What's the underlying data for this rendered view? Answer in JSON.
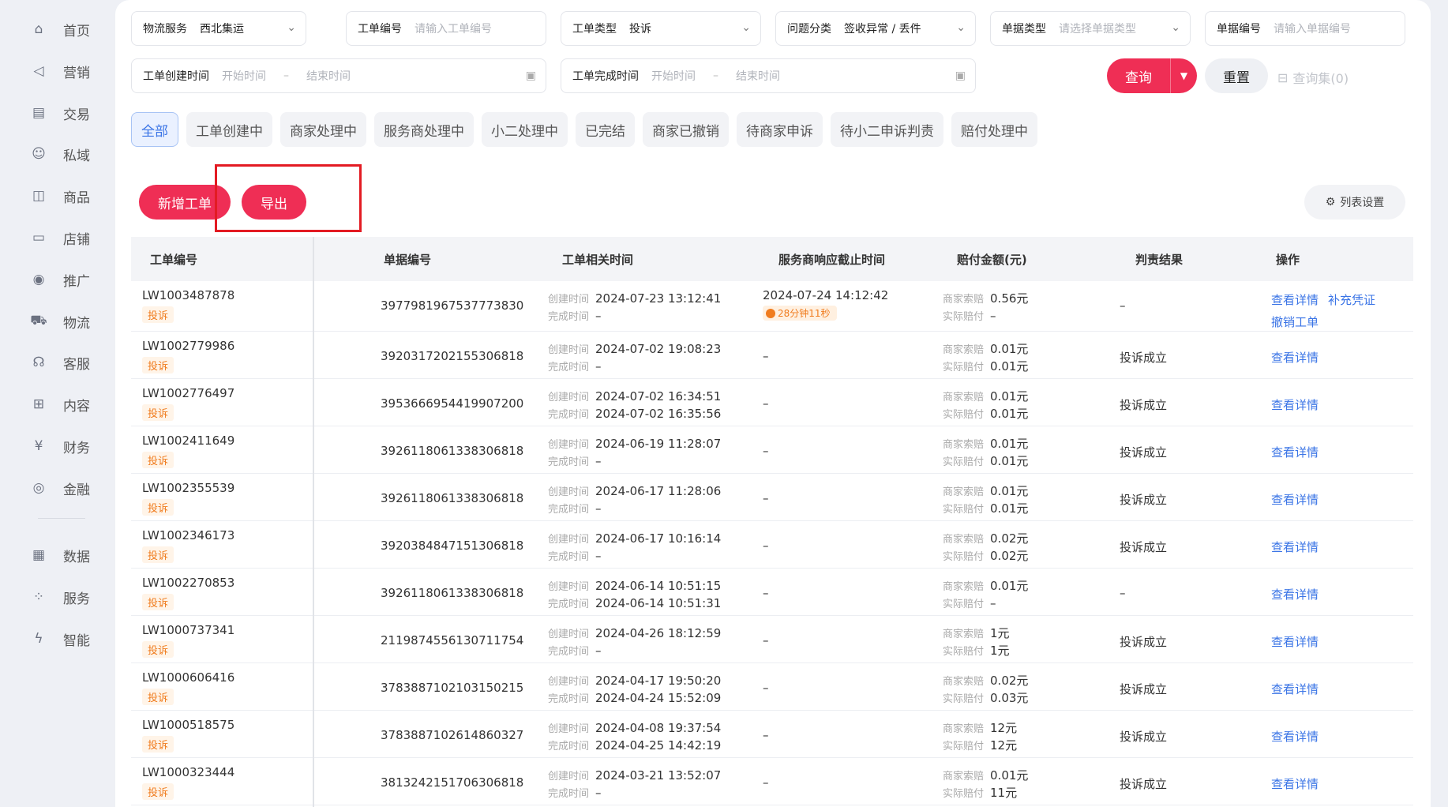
{
  "sidebar": [
    {
      "label": "首页",
      "icon": "home-icon",
      "glyph": "⌂"
    },
    {
      "label": "营销",
      "icon": "megaphone-icon",
      "glyph": "◁"
    },
    {
      "label": "交易",
      "icon": "receipt-icon",
      "glyph": "▤"
    },
    {
      "label": "私域",
      "icon": "users-icon",
      "glyph": "☺"
    },
    {
      "label": "商品",
      "icon": "bag-icon",
      "glyph": "◫"
    },
    {
      "label": "店铺",
      "icon": "store-icon",
      "glyph": "▭"
    },
    {
      "label": "推广",
      "icon": "pin-icon",
      "glyph": "◉"
    },
    {
      "label": "物流",
      "icon": "truck-icon",
      "glyph": "⛟"
    },
    {
      "label": "客服",
      "icon": "headset-icon",
      "glyph": "☊"
    },
    {
      "label": "内容",
      "icon": "content-icon",
      "glyph": "⊞"
    },
    {
      "label": "财务",
      "icon": "yuan-icon",
      "glyph": "¥"
    },
    {
      "label": "金融",
      "icon": "coin-icon",
      "glyph": "◎"
    },
    {
      "label": "数据",
      "icon": "chart-icon",
      "glyph": "▦"
    },
    {
      "label": "服务",
      "icon": "grid-icon",
      "glyph": "⁘"
    },
    {
      "label": "智能",
      "icon": "bolt-icon",
      "glyph": "ϟ"
    }
  ],
  "filters": {
    "logistics": {
      "label": "物流服务",
      "value": "西北集运"
    },
    "ticket_no": {
      "label": "工单编号",
      "placeholder": "请输入工单编号"
    },
    "ticket_type": {
      "label": "工单类型",
      "value": "投诉"
    },
    "issue": {
      "label": "问题分类",
      "value": "签收异常 / 丢件"
    },
    "doc_type": {
      "label": "单据类型",
      "placeholder": "请选择单据类型"
    },
    "doc_no": {
      "label": "单据编号",
      "placeholder": "请输入单据编号"
    },
    "created": {
      "label": "工单创建时间",
      "start": "开始时间",
      "end": "结束时间"
    },
    "finished": {
      "label": "工单完成时间",
      "start": "开始时间",
      "end": "结束时间"
    }
  },
  "buttons": {
    "query": "查询",
    "reset": "重置",
    "query_set": "查询集(0)",
    "new": "新增工单",
    "export": "导出",
    "col_settings": "列表设置"
  },
  "tabs": [
    "全部",
    "工单创建中",
    "商家处理中",
    "服务商处理中",
    "小二处理中",
    "已完结",
    "商家已撤销",
    "待商家申诉",
    "待小二申诉判责",
    "赔付处理中"
  ],
  "columns": [
    "工单编号",
    "单据编号",
    "工单相关时间",
    "服务商响应截止时间",
    "赔付金额(元)",
    "判责结果",
    "操作"
  ],
  "time_labels": {
    "created": "创建时间",
    "finished": "完成时间"
  },
  "amount_labels": {
    "claim": "商家索赔",
    "actual": "实际赔付"
  },
  "rows": [
    {
      "id": "LW1003487878",
      "tag": "投诉",
      "doc": "3977981967537773830",
      "created": "2024-07-23 13:12:41",
      "finished": "–",
      "deadline": "2024-07-24 14:12:42",
      "countdown": "28分钟11秒",
      "claim": "0.56元",
      "actual": "–",
      "result": "–",
      "actions": [
        "查看详情",
        "补充凭证",
        "撤销工单"
      ]
    },
    {
      "id": "LW1002779986",
      "tag": "投诉",
      "doc": "3920317202155306818",
      "created": "2024-07-02 19:08:23",
      "finished": "–",
      "deadline": "–",
      "claim": "0.01元",
      "actual": "0.01元",
      "result": "投诉成立",
      "actions": [
        "查看详情"
      ]
    },
    {
      "id": "LW1002776497",
      "tag": "投诉",
      "doc": "3953666954419907200",
      "created": "2024-07-02 16:34:51",
      "finished": "2024-07-02 16:35:56",
      "deadline": "–",
      "claim": "0.01元",
      "actual": "0.01元",
      "result": "投诉成立",
      "actions": [
        "查看详情"
      ]
    },
    {
      "id": "LW1002411649",
      "tag": "投诉",
      "doc": "3926118061338306818",
      "created": "2024-06-19 11:28:07",
      "finished": "–",
      "deadline": "–",
      "claim": "0.01元",
      "actual": "0.01元",
      "result": "投诉成立",
      "actions": [
        "查看详情"
      ]
    },
    {
      "id": "LW1002355539",
      "tag": "投诉",
      "doc": "3926118061338306818",
      "created": "2024-06-17 11:28:06",
      "finished": "–",
      "deadline": "–",
      "claim": "0.01元",
      "actual": "0.01元",
      "result": "投诉成立",
      "actions": [
        "查看详情"
      ]
    },
    {
      "id": "LW1002346173",
      "tag": "投诉",
      "doc": "3920384847151306818",
      "created": "2024-06-17 10:16:14",
      "finished": "–",
      "deadline": "–",
      "claim": "0.02元",
      "actual": "0.02元",
      "result": "投诉成立",
      "actions": [
        "查看详情"
      ]
    },
    {
      "id": "LW1002270853",
      "tag": "投诉",
      "doc": "3926118061338306818",
      "created": "2024-06-14 10:51:15",
      "finished": "2024-06-14 10:51:31",
      "deadline": "–",
      "claim": "0.01元",
      "actual": "–",
      "result": "–",
      "actions": [
        "查看详情"
      ]
    },
    {
      "id": "LW1000737341",
      "tag": "投诉",
      "doc": "2119874556130711754",
      "created": "2024-04-26 18:12:59",
      "finished": "–",
      "deadline": "–",
      "claim": "1元",
      "actual": "1元",
      "result": "投诉成立",
      "actions": [
        "查看详情"
      ]
    },
    {
      "id": "LW1000606416",
      "tag": "投诉",
      "doc": "3783887102103150215",
      "created": "2024-04-17 19:50:20",
      "finished": "2024-04-24 15:52:09",
      "deadline": "–",
      "claim": "0.02元",
      "actual": "0.03元",
      "result": "投诉成立",
      "actions": [
        "查看详情"
      ]
    },
    {
      "id": "LW1000518575",
      "tag": "投诉",
      "doc": "3783887102614860327",
      "created": "2024-04-08 19:37:54",
      "finished": "2024-04-25 14:42:19",
      "deadline": "–",
      "claim": "12元",
      "actual": "12元",
      "result": "投诉成立",
      "actions": [
        "查看详情"
      ]
    },
    {
      "id": "LW1000323444",
      "tag": "投诉",
      "doc": "3813242151706306818",
      "created": "2024-03-21 13:52:07",
      "finished": "–",
      "deadline": "–",
      "claim": "0.01元",
      "actual": "11元",
      "result": "投诉成立",
      "actions": [
        "查看详情"
      ]
    }
  ],
  "colors": {
    "primary": "#ef2e55",
    "link": "#3a74e6",
    "tag": "#f07c1e",
    "highlight": "#e31b23"
  }
}
